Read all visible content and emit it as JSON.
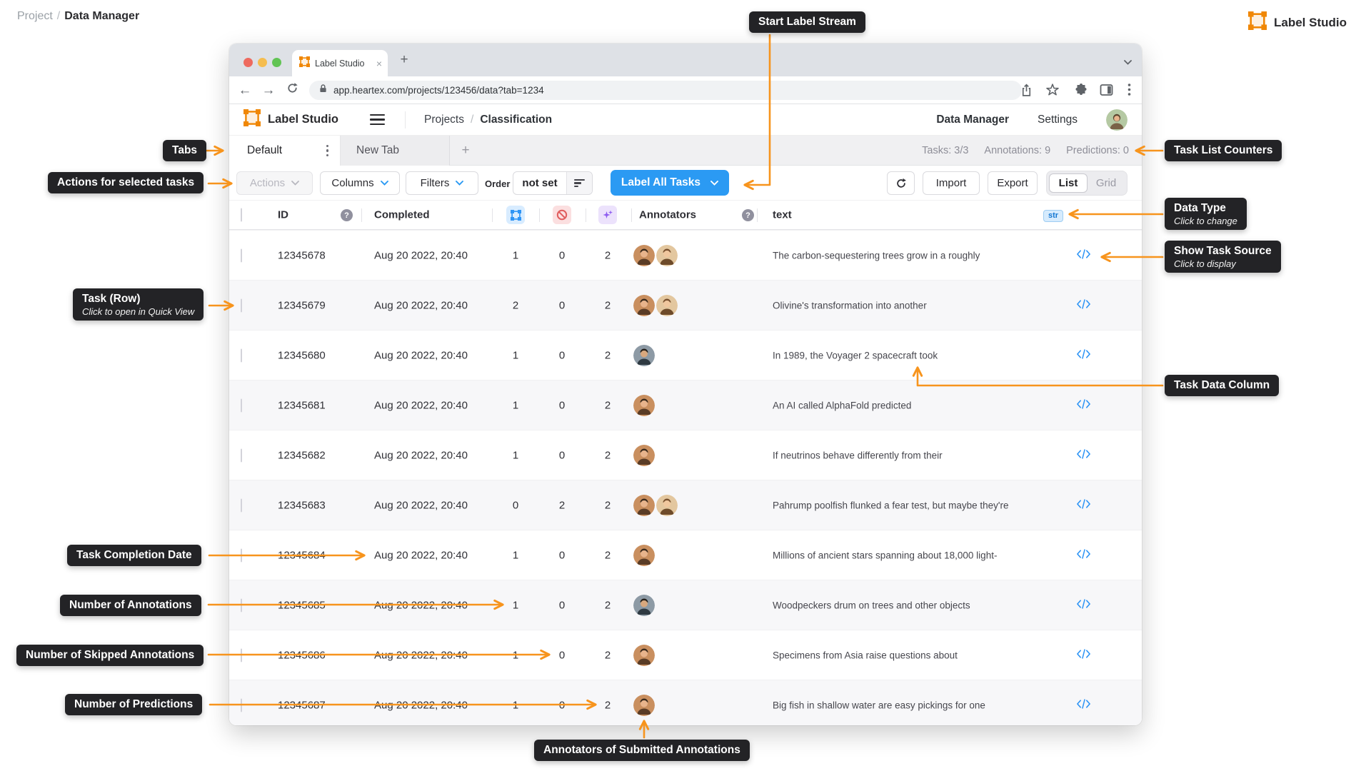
{
  "page": {
    "breadcrumb_project": "Project",
    "breadcrumb_sep": "/",
    "breadcrumb_current": "Data Manager",
    "brand": "Label Studio"
  },
  "browser": {
    "tab_title": "Label Studio",
    "tab_close": "×",
    "new_tab": "+",
    "url": "app.heartex.com/projects/123456/data?tab=1234"
  },
  "app": {
    "header": {
      "brand": "Label Studio",
      "crumb_projects": "Projects",
      "crumb_sep": "/",
      "crumb_project_name": "Classification",
      "nav_data_manager": "Data Manager",
      "nav_settings": "Settings"
    },
    "tabs_bar": {
      "active_tab": "Default",
      "second_tab": "New Tab",
      "add_tab": "+",
      "counters": {
        "tasks": "Tasks: 3/3",
        "annotations": "Annotations: 9",
        "predictions": "Predictions: 0"
      }
    },
    "toolbar": {
      "actions": "Actions",
      "columns": "Columns",
      "filters": "Filters",
      "order_label": "Order",
      "order_value": "not set",
      "label_all_tasks": "Label All Tasks",
      "import": "Import",
      "export": "Export",
      "view_list": "List",
      "view_grid": "Grid"
    },
    "table": {
      "headers": {
        "id": "ID",
        "completed": "Completed",
        "annotators": "Annotators",
        "text": "text"
      },
      "data_type_badge": "str",
      "rows": [
        {
          "id": "12345678",
          "completed": "Aug 20 2022, 20:40",
          "annotations": "1",
          "skipped": "0",
          "predictions": "2",
          "annotators": [
            "f1",
            "m1"
          ],
          "text": "The carbon-sequestering trees grow in a roughly"
        },
        {
          "id": "12345679",
          "completed": "Aug 20 2022, 20:40",
          "annotations": "2",
          "skipped": "0",
          "predictions": "2",
          "annotators": [
            "f1",
            "m1"
          ],
          "text": "Olivine's transformation into another"
        },
        {
          "id": "12345680",
          "completed": "Aug 20 2022, 20:40",
          "annotations": "1",
          "skipped": "0",
          "predictions": "2",
          "annotators": [
            "m2"
          ],
          "text": "In 1989, the Voyager 2 spacecraft took"
        },
        {
          "id": "12345681",
          "completed": "Aug 20 2022, 20:40",
          "annotations": "1",
          "skipped": "0",
          "predictions": "2",
          "annotators": [
            "f1"
          ],
          "text": "An AI called AlphaFold predicted"
        },
        {
          "id": "12345682",
          "completed": "Aug 20 2022, 20:40",
          "annotations": "1",
          "skipped": "0",
          "predictions": "2",
          "annotators": [
            "f1"
          ],
          "text": "If neutrinos behave differently from their"
        },
        {
          "id": "12345683",
          "completed": "Aug 20 2022, 20:40",
          "annotations": "0",
          "skipped": "2",
          "predictions": "2",
          "annotators": [
            "f1",
            "m1"
          ],
          "text": "Pahrump poolfish flunked a fear test, but maybe they're"
        },
        {
          "id": "12345684",
          "completed": "Aug 20 2022, 20:40",
          "annotations": "1",
          "skipped": "0",
          "predictions": "2",
          "annotators": [
            "f1"
          ],
          "text": "Millions of ancient stars spanning about 18,000 light-"
        },
        {
          "id": "12345685",
          "completed": "Aug 20 2022, 20:40",
          "annotations": "1",
          "skipped": "0",
          "predictions": "2",
          "annotators": [
            "m2"
          ],
          "text": "Woodpeckers drum on trees and other objects"
        },
        {
          "id": "12345686",
          "completed": "Aug 20 2022, 20:40",
          "annotations": "1",
          "skipped": "0",
          "predictions": "2",
          "annotators": [
            "f1"
          ],
          "text": "Specimens from Asia raise questions about"
        },
        {
          "id": "12345687",
          "completed": "Aug 20 2022, 20:40",
          "annotations": "1",
          "skipped": "0",
          "predictions": "2",
          "annotators": [
            "f1"
          ],
          "text": "Big fish in shallow water are easy pickings for one"
        }
      ]
    }
  },
  "callouts": {
    "start_label_stream": {
      "title": "Start Label Stream"
    },
    "tabs": {
      "title": "Tabs"
    },
    "actions": {
      "title": "Actions for selected tasks"
    },
    "task_list_counters": {
      "title": "Task List Counters"
    },
    "data_type": {
      "title": "Data Type",
      "subtitle": "Click to change"
    },
    "show_task_source": {
      "title": "Show Task Source",
      "subtitle": "Click to display"
    },
    "task_row": {
      "title": "Task (Row)",
      "subtitle": "Click to open in Quick View"
    },
    "task_data_column": {
      "title": "Task Data Column"
    },
    "task_completion_date": {
      "title": "Task Completion Date"
    },
    "number_of_annotations": {
      "title": "Number of Annotations"
    },
    "number_of_skipped": {
      "title": "Number of Skipped Annotations"
    },
    "number_of_predictions": {
      "title": "Number of Predictions"
    },
    "annotators_of_submitted": {
      "title": "Annotators of Submitted Annotations"
    }
  },
  "icons": {
    "label-studio-logo-icon": "orange selection-box",
    "annotations-count-icon": "blue bounding-box",
    "skipped-count-icon": "red no-entry",
    "predictions-count-icon": "purple sparkles",
    "show-source-icon": "blue code </>",
    "help-icon": "?",
    "lock-icon": "padlock",
    "refresh-icon": "circular arrow",
    "sort-icon": "descending bars"
  },
  "colors": {
    "accent_orange": "#F7941D",
    "logo_orange": "#F08705",
    "primary_blue": "#2B9AF3",
    "row_alt": "#F7F7F9",
    "callout_bg": "#232326"
  }
}
